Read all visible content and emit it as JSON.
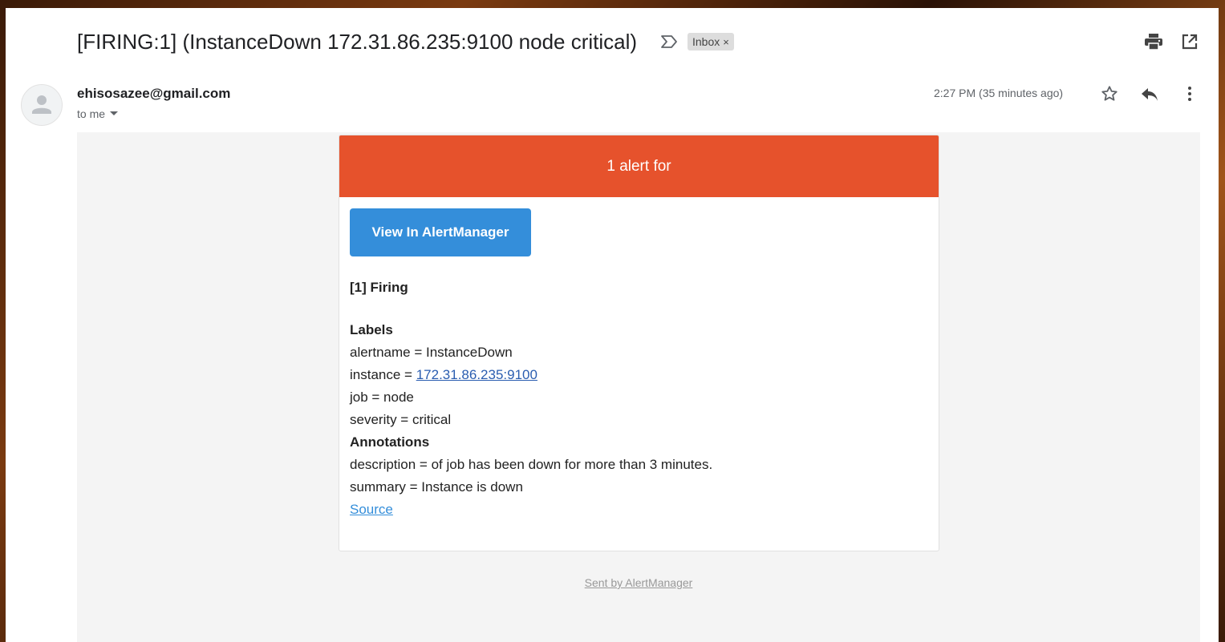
{
  "header": {
    "subject": "[FIRING:1] (InstanceDown 172.31.86.235:9100 node critical)",
    "importance_icon": "importance-marker-icon",
    "label_chip": "Inbox",
    "chip_remove": "×",
    "print_icon": "print-icon",
    "new_window_icon": "open-in-new-window-icon"
  },
  "message": {
    "sender": "ehisosazee@gmail.com",
    "recipient": "to me",
    "time": "2:27 PM (35 minutes ago)",
    "avatar_icon": "default-avatar-icon",
    "star_icon": "star-icon",
    "reply_icon": "reply-icon",
    "more_icon": "more-vert-icon"
  },
  "email": {
    "banner": "1 alert for",
    "banner_color": "#e6522c",
    "button_label": "View In AlertManager",
    "button_color": "#348eda",
    "firing_heading": "[1] Firing",
    "labels_heading": "Labels",
    "alertname": "alertname = InstanceDown",
    "instance_prefix": "instance = ",
    "instance_link": "172.31.86.235:9100",
    "job": "job = node",
    "severity": "severity = critical",
    "annotations_heading": "Annotations",
    "description": "description = of job has been down for more than 3 minutes.",
    "summary": "summary = Instance is down",
    "source_link": "Source",
    "footer": "Sent by AlertManager"
  }
}
